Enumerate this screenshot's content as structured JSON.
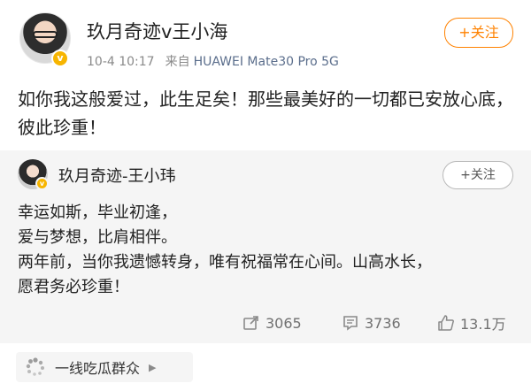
{
  "post": {
    "author": "玖月奇迹v王小海",
    "timestamp": "10-4 10:17",
    "source_prefix": "来自",
    "device": "HUAWEI Mate30 Pro 5G",
    "follow_label": "+关注",
    "text": "如你我这般爱过，此生足矣！那些最美好的一切都已安放心底，彼此珍重！",
    "badge_icon": "verified-v-icon"
  },
  "repost": {
    "author": "玖月奇迹-王小玮",
    "follow_label": "+关注",
    "text_lines": [
      "幸运如斯，毕业初逢，",
      "爱与梦想，比肩相伴。",
      "两年前，当你我遗憾转身，唯有祝福常在心间。山高水长，",
      "愿君务必珍重！"
    ],
    "stats": {
      "reposts": "3065",
      "comments": "3736",
      "likes": "13.1万"
    }
  },
  "topic": {
    "label": "一线吃瓜群众",
    "icon": "loading-dots-icon"
  },
  "colors": {
    "accent": "#ff8200",
    "badge": "#f7b500",
    "card_bg": "#f5f5f5",
    "link": "#5b6e8c"
  }
}
